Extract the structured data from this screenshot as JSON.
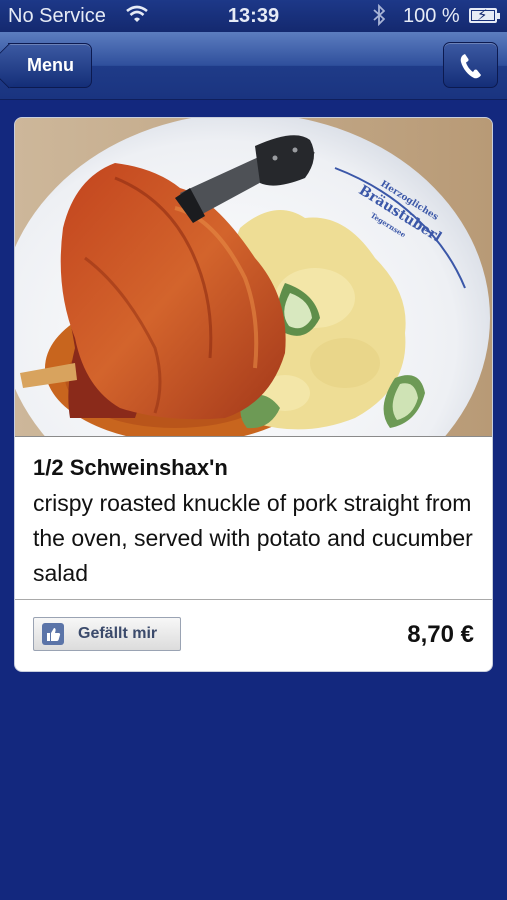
{
  "status_bar": {
    "carrier": "No Service",
    "time": "13:39",
    "battery": "100 %",
    "icons": [
      "wifi-icon",
      "bluetooth-icon",
      "battery-charging-icon"
    ]
  },
  "nav": {
    "back_label": "Menu",
    "call_icon": "phone-icon"
  },
  "dish": {
    "photo": "roast-pork-knuckle-photo",
    "plate_text": "Herzogliches Bräustüberl Tegernsee",
    "name": "1/2 Schweinshax'n",
    "description": "crispy roasted knuckle of pork straight from the oven, served with potato and cucumber salad",
    "like_label": "Gefällt mir",
    "price": "8,70 €"
  },
  "colors": {
    "background": "#13287e",
    "nav": "#2f4f9c",
    "card": "#ffffff"
  }
}
